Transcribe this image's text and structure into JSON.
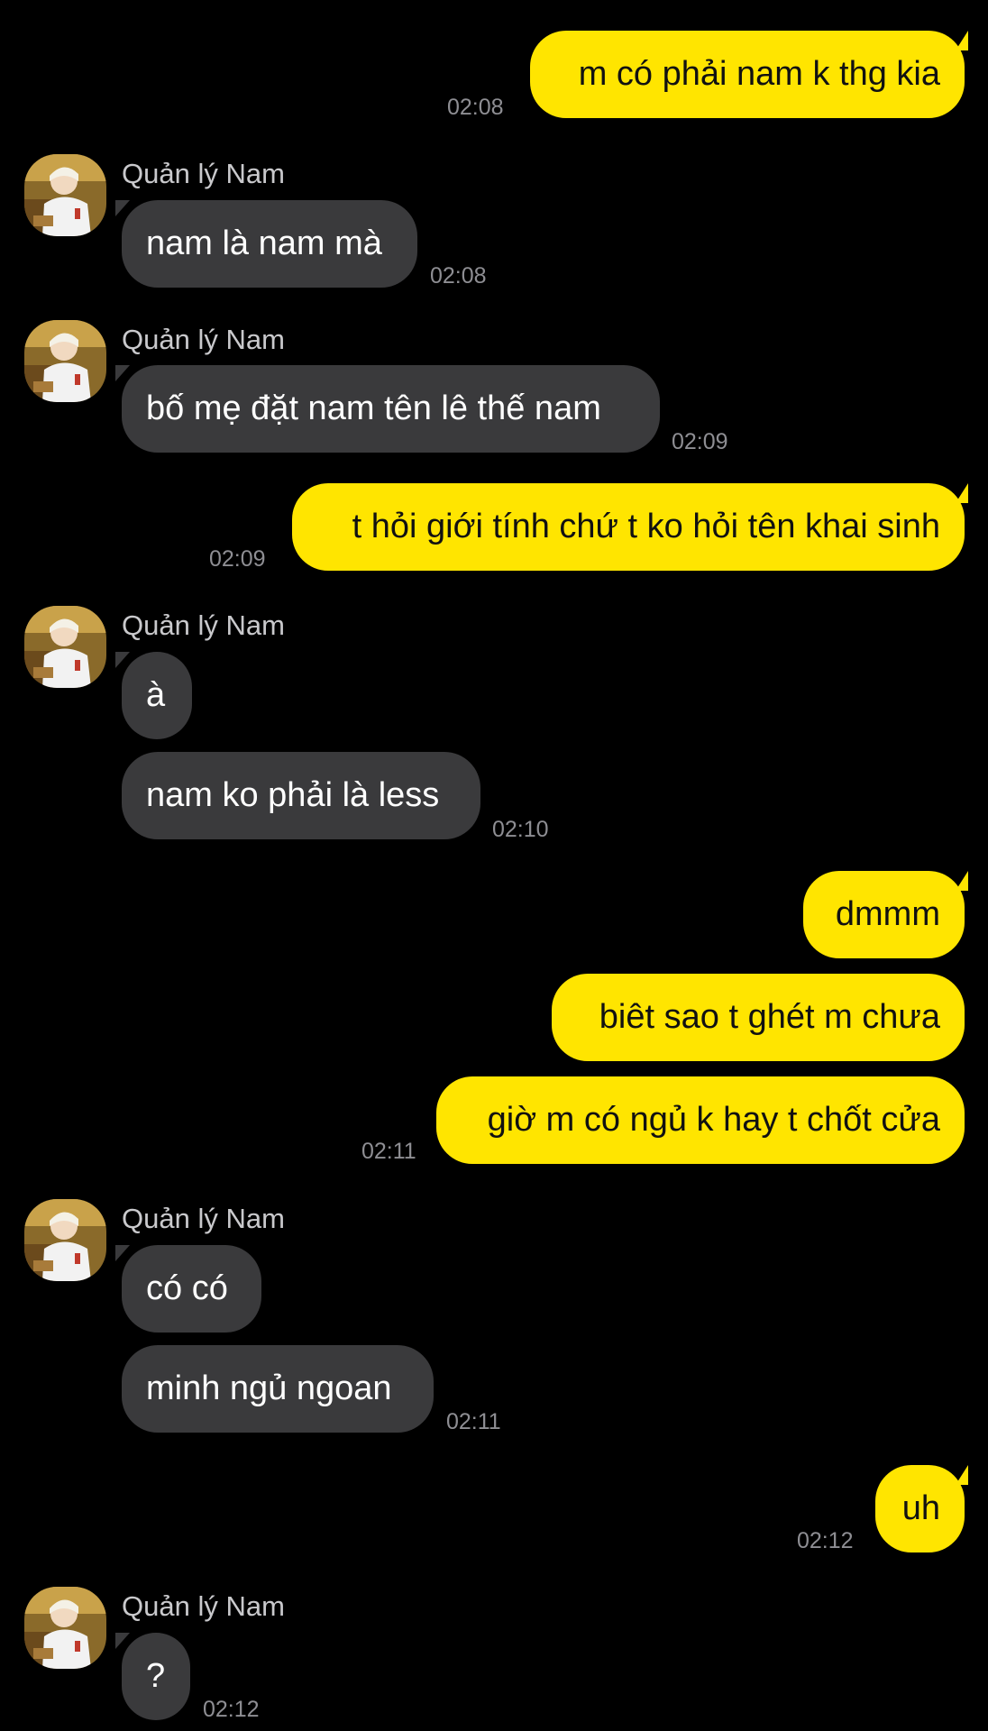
{
  "colors": {
    "background": "#000000",
    "outgoing_bubble": "#FFE500",
    "outgoing_text": "#111111",
    "incoming_bubble": "#3A3A3C",
    "incoming_text": "#FFFFFF",
    "timestamp": "#8E8E93",
    "sender_name": "#C9C9CC"
  },
  "contact": {
    "name": "Quản lý Nam",
    "avatar_icon": "profile-photo"
  },
  "messages": [
    {
      "direction": "out",
      "text": "m có phải nam k thg kia",
      "time": "02:08"
    },
    {
      "direction": "in",
      "sender": "Quản lý Nam",
      "text": "nam là nam mà",
      "time": "02:08"
    },
    {
      "direction": "in",
      "sender": "Quản lý Nam",
      "text": "bố mẹ đặt nam tên lê thế nam",
      "time": "02:09"
    },
    {
      "direction": "out",
      "text": "t hỏi giới tính chứ t ko hỏi tên khai sinh",
      "time": "02:09"
    },
    {
      "direction": "in",
      "sender": "Quản lý Nam",
      "text": "à",
      "time": ""
    },
    {
      "direction": "in",
      "text": "nam ko phải là less",
      "time": "02:10"
    },
    {
      "direction": "out",
      "text": "dmmm",
      "time": ""
    },
    {
      "direction": "out",
      "text": "biêt sao t ghét m chưa",
      "time": ""
    },
    {
      "direction": "out",
      "text": "giờ m có ngủ k hay t chốt cửa",
      "time": "02:11"
    },
    {
      "direction": "in",
      "sender": "Quản lý Nam",
      "text": "có có",
      "time": ""
    },
    {
      "direction": "in",
      "text": "minh ngủ ngoan",
      "time": "02:11"
    },
    {
      "direction": "out",
      "text": "uh",
      "time": "02:12"
    },
    {
      "direction": "in",
      "sender": "Quản lý Nam",
      "text": "?",
      "time": "02:12"
    }
  ]
}
